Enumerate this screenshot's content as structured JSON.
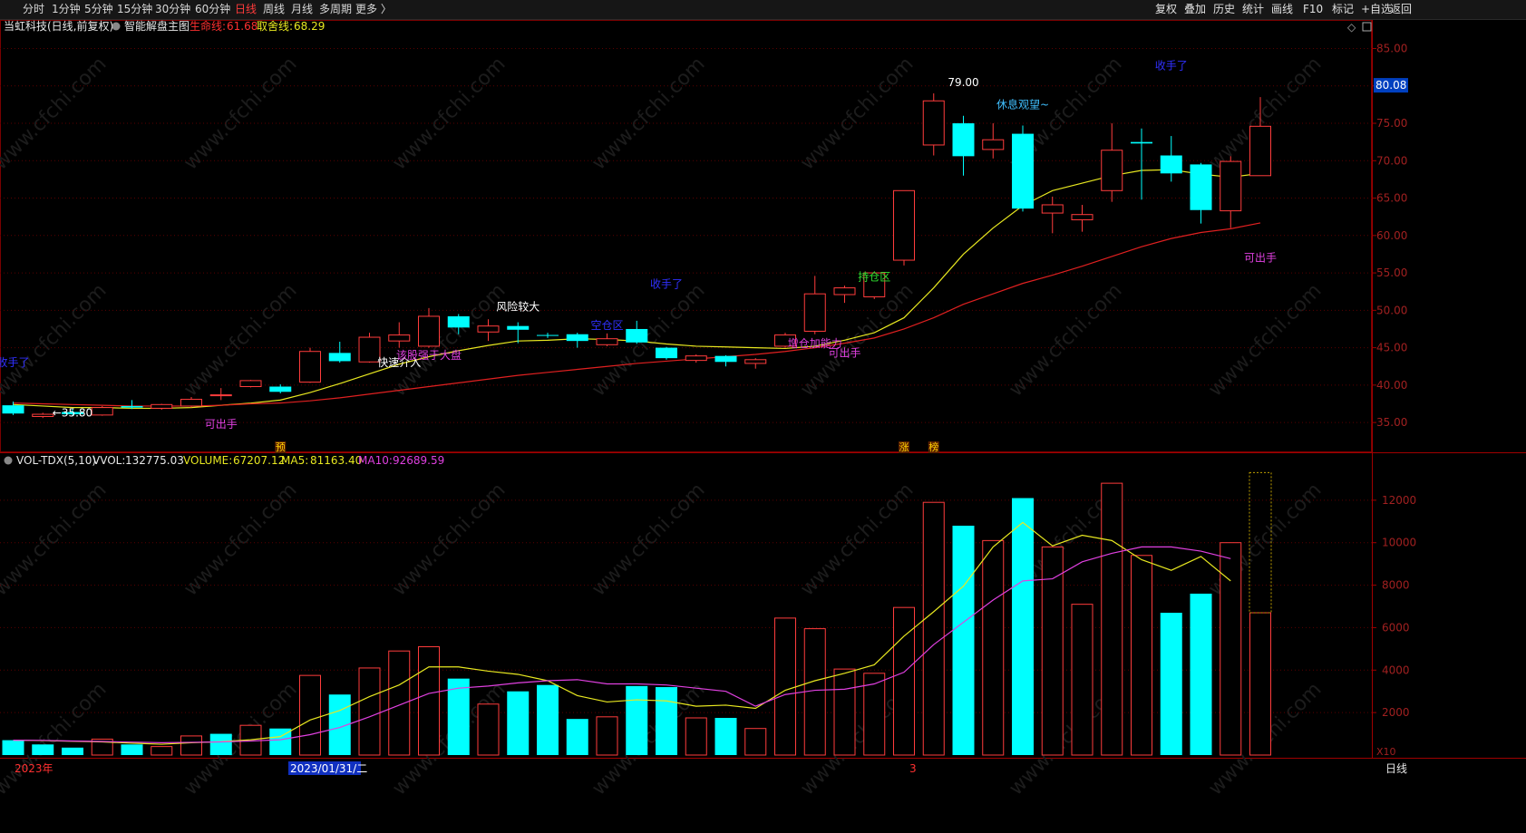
{
  "toolbar": {
    "period_tabs": [
      "分时",
      "1分钟",
      "5分钟",
      "15分钟",
      "30分钟",
      "60分钟",
      "日线",
      "周线",
      "月线",
      "多周期",
      "更多 〉"
    ],
    "active_tab": "日线",
    "right_buttons": [
      "复权",
      "叠加",
      "历史",
      "统计",
      "画线",
      "F10",
      "标记",
      "+自选",
      "返回"
    ]
  },
  "price_panel": {
    "stock_title": "当虹科技(日线,前复权)",
    "indicator_name": "智能解盘主图",
    "life_line_label": "生命线:",
    "life_line_value": "61.68",
    "take_line_label": "取舍线:",
    "take_line_value": "68.29",
    "current_price_tag": "80.08",
    "colors": {
      "up": "#ff3c3c",
      "down": "#00ffff",
      "life_line": "#e02020",
      "take_line": "#e8e820",
      "annotation_purple": "#e040e0",
      "annotation_blue": "#3030ff",
      "annotation_green": "#30e030"
    }
  },
  "volume_panel": {
    "indicator_label": "VOL-TDX(5,10)",
    "vvol_label": "VVOL:",
    "vvol_value": "132775.03",
    "volume_label": "VOLUME:",
    "volume_value": "67207.12",
    "ma5_label": "MA5:",
    "ma5_value": "81163.40",
    "ma10_label": "MA10:",
    "ma10_value": "92689.59",
    "unit_tag": "X10"
  },
  "bottom_axis": {
    "year_label": "2023年",
    "cursor_date": "2023/01/31/二",
    "month_label": "3",
    "period_label": "日线"
  },
  "watermark": "www.cfchi.com",
  "chart_data": [
    {
      "type": "candlestick",
      "title": "当虹科技(日线,前复权)",
      "ylim": [
        31.5,
        87
      ],
      "y_ticks": [
        "35.00",
        "40.00",
        "45.00",
        "50.00",
        "55.00",
        "60.00",
        "65.00",
        "70.00",
        "75.00",
        "80.00",
        "85.00"
      ],
      "candles": [
        {
          "o": 37.3,
          "h": 37.8,
          "l": 36.0,
          "c": 36.2
        },
        {
          "o": 35.8,
          "h": 36.3,
          "l": 35.6,
          "c": 36.1
        },
        {
          "o": 36.4,
          "h": 36.8,
          "l": 36.0,
          "c": 36.1
        },
        {
          "o": 36.0,
          "h": 37.2,
          "l": 35.9,
          "c": 37.0
        },
        {
          "o": 37.2,
          "h": 38.0,
          "l": 36.8,
          "c": 37.0
        },
        {
          "o": 36.9,
          "h": 37.5,
          "l": 36.7,
          "c": 37.4
        },
        {
          "o": 37.2,
          "h": 38.4,
          "l": 37.0,
          "c": 38.1
        },
        {
          "o": 38.6,
          "h": 39.6,
          "l": 38.0,
          "c": 38.7
        },
        {
          "o": 39.8,
          "h": 40.7,
          "l": 39.7,
          "c": 40.6
        },
        {
          "o": 39.8,
          "h": 40.1,
          "l": 38.9,
          "c": 39.1
        },
        {
          "o": 40.4,
          "h": 45.0,
          "l": 40.3,
          "c": 44.5
        },
        {
          "o": 44.3,
          "h": 45.8,
          "l": 43.0,
          "c": 43.2
        },
        {
          "o": 43.1,
          "h": 47.0,
          "l": 43.0,
          "c": 46.4
        },
        {
          "o": 45.9,
          "h": 48.4,
          "l": 45.0,
          "c": 46.7
        },
        {
          "o": 45.2,
          "h": 50.3,
          "l": 45.0,
          "c": 49.2
        },
        {
          "o": 49.2,
          "h": 49.5,
          "l": 46.8,
          "c": 47.7
        },
        {
          "o": 47.1,
          "h": 48.8,
          "l": 45.9,
          "c": 47.9
        },
        {
          "o": 47.9,
          "h": 48.4,
          "l": 45.6,
          "c": 47.4
        },
        {
          "o": 46.7,
          "h": 47.0,
          "l": 46.3,
          "c": 46.6
        },
        {
          "o": 46.8,
          "h": 47.0,
          "l": 45.0,
          "c": 45.9
        },
        {
          "o": 45.4,
          "h": 46.9,
          "l": 45.2,
          "c": 46.2
        },
        {
          "o": 47.5,
          "h": 48.6,
          "l": 45.5,
          "c": 45.7
        },
        {
          "o": 45.0,
          "h": 45.1,
          "l": 43.4,
          "c": 43.6
        },
        {
          "o": 43.3,
          "h": 44.1,
          "l": 43.0,
          "c": 43.9
        },
        {
          "o": 43.9,
          "h": 44.0,
          "l": 42.5,
          "c": 43.1
        },
        {
          "o": 42.9,
          "h": 43.6,
          "l": 42.2,
          "c": 43.4
        },
        {
          "o": 45.2,
          "h": 47.0,
          "l": 45.0,
          "c": 46.7
        },
        {
          "o": 47.2,
          "h": 54.6,
          "l": 46.8,
          "c": 52.2
        },
        {
          "o": 52.1,
          "h": 53.3,
          "l": 51.0,
          "c": 53.0
        },
        {
          "o": 51.8,
          "h": 55.0,
          "l": 51.5,
          "c": 55.0
        },
        {
          "o": 56.7,
          "h": 66.0,
          "l": 56.0,
          "c": 66.0
        },
        {
          "o": 72.1,
          "h": 79.0,
          "l": 70.7,
          "c": 78.0
        },
        {
          "o": 75.0,
          "h": 76.0,
          "l": 68.0,
          "c": 70.6
        },
        {
          "o": 71.5,
          "h": 75.0,
          "l": 70.3,
          "c": 72.8
        },
        {
          "o": 73.6,
          "h": 74.7,
          "l": 63.2,
          "c": 63.6
        },
        {
          "o": 63.0,
          "h": 65.2,
          "l": 60.3,
          "c": 64.1
        },
        {
          "o": 62.1,
          "h": 64.1,
          "l": 60.5,
          "c": 62.8
        },
        {
          "o": 66.0,
          "h": 75.0,
          "l": 64.5,
          "c": 71.4
        },
        {
          "o": 72.5,
          "h": 74.3,
          "l": 64.8,
          "c": 72.3
        },
        {
          "o": 70.7,
          "h": 73.3,
          "l": 67.2,
          "c": 68.3
        },
        {
          "o": 69.5,
          "h": 69.7,
          "l": 61.6,
          "c": 63.4
        },
        {
          "o": 63.3,
          "h": 70.6,
          "l": 61.0,
          "c": 69.9
        },
        {
          "o": 68.0,
          "h": 78.5,
          "l": 68.0,
          "c": 74.6
        }
      ],
      "series": [
        {
          "name": "取舍线",
          "values": [
            37.4,
            37.2,
            37.0,
            37.0,
            36.9,
            36.9,
            37.0,
            37.3,
            37.6,
            38.0,
            39.0,
            40.2,
            41.5,
            42.8,
            43.8,
            44.6,
            45.3,
            45.9,
            46.0,
            46.2,
            46.1,
            45.9,
            45.5,
            45.2,
            45.1,
            45.0,
            44.9,
            45.2,
            46.0,
            47.0,
            49.0,
            53.0,
            57.5,
            61.0,
            64.0,
            66.0,
            67.0,
            68.0,
            68.7,
            68.8,
            68.2,
            67.8,
            68.29
          ]
        },
        {
          "name": "生命线",
          "values": [
            37.6,
            37.5,
            37.4,
            37.3,
            37.2,
            37.2,
            37.2,
            37.3,
            37.5,
            37.6,
            37.9,
            38.3,
            38.8,
            39.3,
            39.8,
            40.3,
            40.8,
            41.3,
            41.7,
            42.1,
            42.5,
            42.9,
            43.2,
            43.5,
            43.8,
            44.1,
            44.5,
            45.0,
            45.6,
            46.3,
            47.5,
            49.0,
            50.8,
            52.2,
            53.6,
            54.7,
            55.9,
            57.2,
            58.5,
            59.6,
            60.4,
            60.9,
            61.68
          ]
        }
      ],
      "annotations": [
        {
          "text": "收手了",
          "i": 0,
          "y": 42.5,
          "color": "blue"
        },
        {
          "text": "←35.80",
          "i": 2,
          "y": 35.8,
          "color": "white"
        },
        {
          "text": "可出手",
          "i": 7,
          "y": 34.3,
          "color": "purple"
        },
        {
          "text": "快速介入",
          "i": 13,
          "y": 42.5,
          "color": "white"
        },
        {
          "text": "该股强于大盘",
          "i": 14,
          "y": 43.5,
          "color": "purple"
        },
        {
          "text": "风险较大",
          "i": 17,
          "y": 50.0,
          "color": "white"
        },
        {
          "text": "空仓区",
          "i": 20,
          "y": 47.5,
          "color": "blue"
        },
        {
          "text": "收手了",
          "i": 22,
          "y": 53.0,
          "color": "blue"
        },
        {
          "text": "增仓加能力",
          "i": 27,
          "y": 45.1,
          "color": "purple"
        },
        {
          "text": "可出手",
          "i": 28,
          "y": 43.8,
          "color": "purple"
        },
        {
          "text": "持仓区",
          "i": 29,
          "y": 54.0,
          "color": "green"
        },
        {
          "text": "79.00",
          "i": 32,
          "y": 80.0,
          "color": "white"
        },
        {
          "text": "休息观望~",
          "i": 34,
          "y": 77.0,
          "color": "teal"
        },
        {
          "text": "收手了",
          "i": 39,
          "y": 82.2,
          "color": "blue"
        },
        {
          "text": "可出手",
          "i": 42,
          "y": 56.5,
          "color": "purple"
        }
      ],
      "markers": [
        {
          "text": "预",
          "i": 9
        },
        {
          "text": "涨",
          "i": 30
        },
        {
          "text": "榜",
          "i": 31
        }
      ]
    },
    {
      "type": "bar",
      "title": "VOL-TDX(5,10)",
      "ylim": [
        0,
        14000
      ],
      "y_ticks": [
        "2000",
        "4000",
        "6000",
        "8000",
        "10000",
        "12000"
      ],
      "values": [
        700,
        500,
        350,
        750,
        500,
        400,
        900,
        1000,
        1400,
        1250,
        3750,
        2850,
        4100,
        4900,
        5100,
        3600,
        2400,
        3000,
        3300,
        1700,
        1800,
        3250,
        3200,
        1750,
        1750,
        1250,
        6450,
        5950,
        4050,
        3850,
        6950,
        11900,
        10800,
        10100,
        12100,
        9800,
        7100,
        12800,
        9400,
        6700,
        7600,
        10000,
        6700
      ],
      "up_down": [
        "d",
        "d",
        "d",
        "u",
        "d",
        "u",
        "u",
        "d",
        "u",
        "d",
        "u",
        "d",
        "u",
        "u",
        "u",
        "d",
        "u",
        "d",
        "d",
        "d",
        "u",
        "d",
        "d",
        "u",
        "d",
        "u",
        "u",
        "u",
        "u",
        "u",
        "u",
        "u",
        "d",
        "u",
        "d",
        "u",
        "u",
        "u",
        "u",
        "d",
        "d",
        "u",
        "u"
      ],
      "ghost_bar_value": 13300,
      "series": [
        {
          "name": "MA5",
          "values": [
            700,
            680,
            650,
            620,
            560,
            510,
            580,
            630,
            720,
            870,
            1650,
            2100,
            2750,
            3300,
            4150,
            4150,
            3950,
            3800,
            3500,
            2800,
            2500,
            2600,
            2550,
            2300,
            2350,
            2200,
            3050,
            3500,
            3850,
            4250,
            5600,
            6750,
            7950,
            9800,
            10950,
            9850,
            10350,
            10100,
            9200,
            8700,
            9350,
            8200
          ]
        },
        {
          "name": "MA10",
          "values": [
            700,
            690,
            660,
            640,
            610,
            580,
            600,
            620,
            660,
            720,
            960,
            1300,
            1800,
            2350,
            2900,
            3150,
            3250,
            3400,
            3500,
            3550,
            3350,
            3350,
            3300,
            3150,
            3000,
            2300,
            2850,
            3050,
            3100,
            3350,
            3900,
            5200,
            6250,
            7300,
            8200,
            8300,
            9100,
            9500,
            9800,
            9800,
            9600,
            9250
          ]
        }
      ]
    }
  ]
}
